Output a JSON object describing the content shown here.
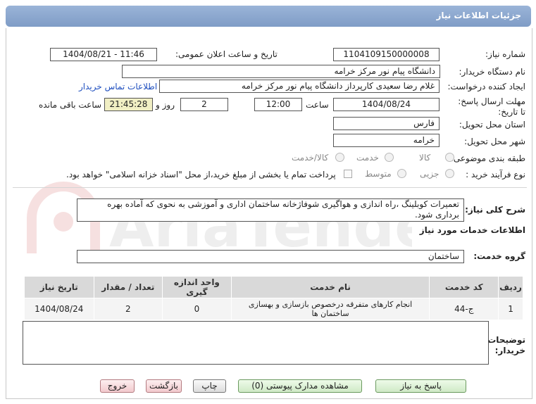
{
  "header": {
    "title": "جزئیات اطلاعات نیاز"
  },
  "form": {
    "need_number_label": "شماره نیاز:",
    "need_number": "1104109150000008",
    "announce_label": "تاریخ و ساعت اعلان عمومی:",
    "announce_value": "1404/08/21 - 11:46",
    "buyer_label": "نام دستگاه خریدار:",
    "buyer_value": "دانشگاه پیام نور مرکز خرامه",
    "creator_label": "ایجاد کننده درخواست:",
    "creator_value": "غلام رضا  سعیدی کارپرداز دانشگاه پیام نور مرکز خرامه",
    "contact_link": "اطلاعات تماس خریدار",
    "deadline_label": "مهلت ارسال پاسخ: تا تاریخ:",
    "deadline_date": "1404/08/24",
    "time_label": "ساعت",
    "deadline_time": "12:00",
    "days_value": "2",
    "days_label": "روز و",
    "remaining_value": "21:45:28",
    "remaining_label": "ساعت باقی مانده",
    "province_label": "استان محل تحویل:",
    "province_value": "فارس",
    "city_label": "شهر محل تحویل:",
    "city_value": "خرامه",
    "category_label": "طبقه بندی موضوعی:",
    "category_options": [
      "کالا",
      "خدمت",
      "کالا/خدمت"
    ],
    "process_label": "نوع فرآیند خرید :",
    "process_options": [
      "جزیی",
      "متوسط"
    ],
    "process_note": "پرداخت تمام یا بخشی از مبلغ خرید،از محل \"اسناد خزانه اسلامی\" خواهد بود.",
    "description_label": "شرح کلی نیاز:",
    "description_value": "تعمیرات کوبلینگ ،راه اندازی و هواگیری شوفاژخانه ساختمان اداری و آموزشی به نحوی که آماده بهره برداری شود.",
    "services_heading": "اطلاعات خدمات مورد نیاز",
    "service_group_label": "گروه خدمت:",
    "service_group_value": "ساختمان",
    "buyer_notes_label": "توضیحات خریدار:",
    "buyer_notes_value": ""
  },
  "table": {
    "headers": [
      "ردیف",
      "کد خدمت",
      "نام خدمت",
      "واحد اندازه گیری",
      "تعداد / مقدار",
      "تاریخ نیاز"
    ],
    "rows": [
      {
        "row": "1",
        "code": "ج-44",
        "name": "انجام کارهای متفرقه درخصوص بازسازی و بهسازی ساختمان ها",
        "unit": "0",
        "qty": "2",
        "date": "1404/08/24"
      }
    ]
  },
  "buttons": {
    "reply": "پاسخ به نیاز",
    "attachments": "مشاهده مدارک پیوستی (0)",
    "print": "چاپ",
    "back": "بازگشت",
    "exit": "خروج"
  },
  "watermark": {
    "text": "AriaTender.net"
  },
  "colors": {
    "title_bar": "#8aa6cf",
    "link": "#1f4fbf",
    "remaining_bg": "#f1efc4"
  }
}
